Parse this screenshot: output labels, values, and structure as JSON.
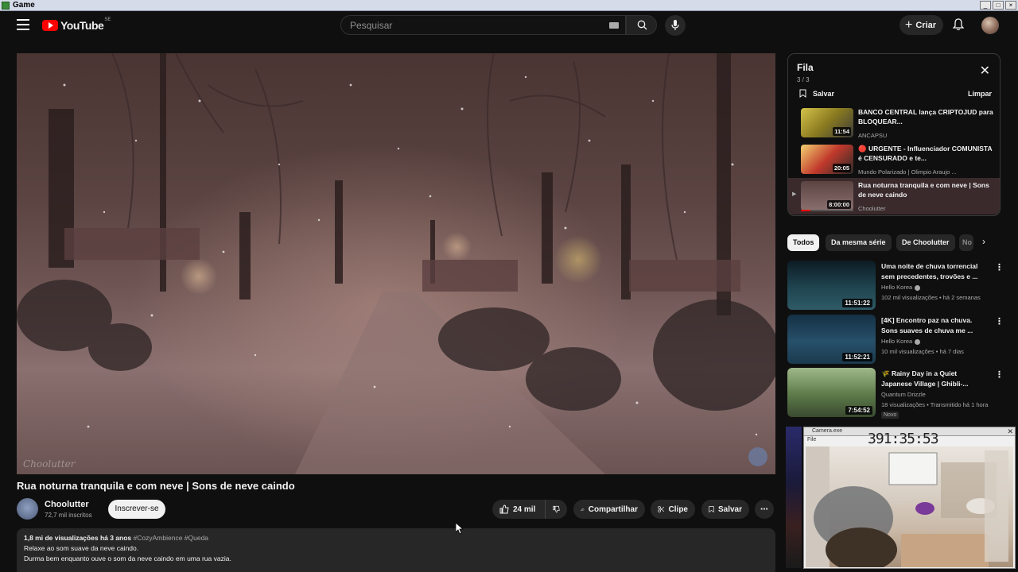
{
  "window": {
    "title": "Game",
    "controls": [
      "_",
      "□",
      "×"
    ]
  },
  "header": {
    "logo_text": "YouTube",
    "logo_country": "SE",
    "search_placeholder": "Pesquisar",
    "create_label": "Criar"
  },
  "video": {
    "title": "Rua noturna tranquila e com neve | Sons de neve caindo",
    "watermark": "Choolutter",
    "channel_name": "Choolutter",
    "subscribers": "72,7 mil inscritos",
    "subscribe_label": "Inscrever-se",
    "likes": "24 mil",
    "share_label": "Compartilhar",
    "clip_label": "Clipe",
    "save_label": "Salvar",
    "description": {
      "views": "1,8 mi de visualizações",
      "age": "há 3 anos",
      "tags": "#CozyAmbience #Queda",
      "line1": "Relaxe ao som suave da neve caindo.",
      "line2": "Durma bem enquanto ouve o som da neve caindo em uma rua vazia."
    }
  },
  "queue": {
    "title": "Fila",
    "count": "3 / 3",
    "save_label": "Salvar",
    "clear_label": "Limpar",
    "items": [
      {
        "title": "BANCO CENTRAL lança CRIPTOJUD para BLOQUEAR...",
        "channel": "ANCAPSU",
        "duration": "11:54"
      },
      {
        "title": "🔴 URGENTE - Influenciador COMUNISTA é CENSURADO e te...",
        "channel": "Mundo Polarizado | Olimpio Araujo ...",
        "duration": "20:05"
      },
      {
        "title": "Rua noturna tranquila e com neve | Sons de neve caindo",
        "channel": "Choolutter",
        "duration": "8:00:00"
      }
    ]
  },
  "chips": [
    "Todos",
    "Da mesma série",
    "De Choolutter",
    "No"
  ],
  "recommendations": [
    {
      "title": "Uma noite de chuva torrencial sem precedentes, trovões e ...",
      "channel": "Hello Korea",
      "meta": "102 mil visualizações • há 2 semanas",
      "duration": "11:51:22",
      "badge": ""
    },
    {
      "title": "[4K] Encontro paz na chuva. Sons suaves de chuva me ...",
      "channel": "Hello Korea",
      "meta": "10 mil visualizações • há 7 dias",
      "duration": "11:52:21",
      "badge": ""
    },
    {
      "title": "🌾 Rainy Day in a Quiet Japanese Village | Ghibli-...",
      "channel": "Quantum Drizzle",
      "meta": "18 visualizações • Transmitido há 1 hora",
      "duration": "7:54:52",
      "badge": "Novo"
    }
  ],
  "camera_window": {
    "title": "Camera.exe",
    "menu": "File",
    "timer": "391:35:53"
  },
  "colors": {
    "accent": "#ff0000",
    "background": "#0f0f0f",
    "surface": "#272727",
    "text": "#f1f1f1",
    "muted": "#aaaaaa"
  }
}
